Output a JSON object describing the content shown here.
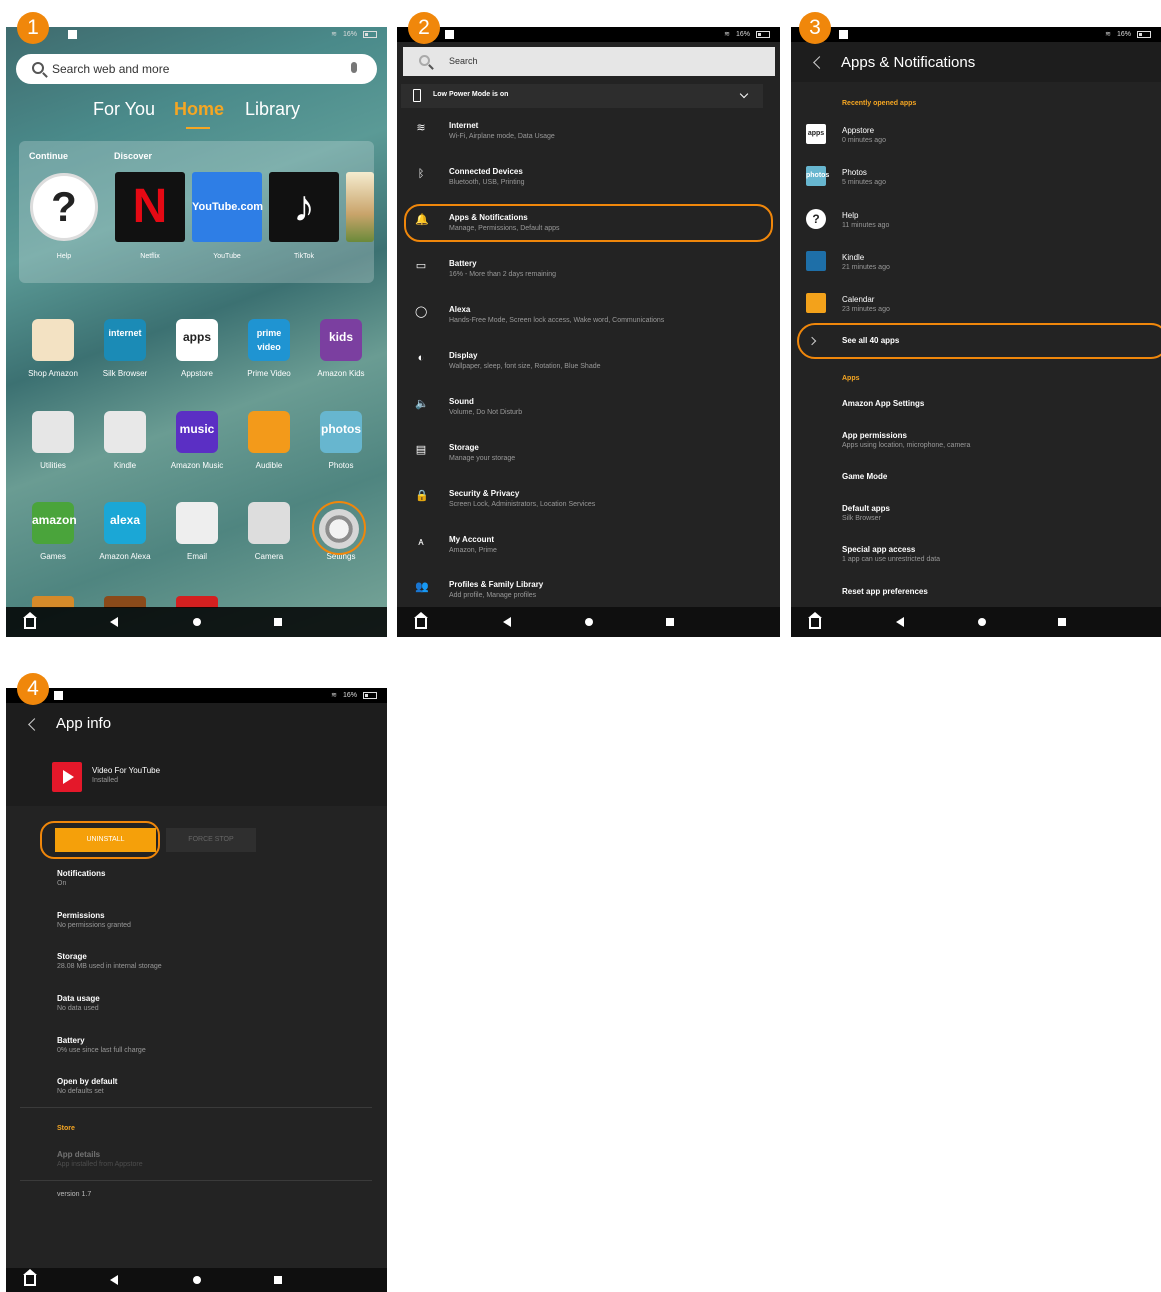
{
  "badges": [
    "1",
    "2",
    "3",
    "4"
  ],
  "status": {
    "battery": "16%"
  },
  "panel1": {
    "search_placeholder": "Search web and more",
    "tabs": [
      "For You",
      "Home",
      "Library"
    ],
    "carousel": {
      "continue_label": "Continue",
      "discover_label": "Discover",
      "tiles": [
        {
          "label": "Help",
          "glyph": "?"
        },
        {
          "label": "Netflix",
          "glyph": "N"
        },
        {
          "label": "YouTube",
          "glyph": "YouTube.com"
        },
        {
          "label": "TikTok",
          "glyph": "♪"
        }
      ]
    },
    "apps": [
      {
        "label": "Shop Amazon",
        "glyph": "",
        "color": "#f3e2c3"
      },
      {
        "label": "Silk Browser",
        "glyph": "internet",
        "color": "#1b8bb6"
      },
      {
        "label": "Appstore",
        "glyph": "apps",
        "color": "#ffffff"
      },
      {
        "label": "Prime Video",
        "glyph": "prime video",
        "color": "#1f94d2"
      },
      {
        "label": "Amazon Kids",
        "glyph": "kids",
        "color": "#7b3fa0"
      },
      {
        "label": "Utilities",
        "glyph": "",
        "color": "#e6e6e6"
      },
      {
        "label": "Kindle",
        "glyph": "",
        "color": "#e8e8e8"
      },
      {
        "label": "Amazon Music",
        "glyph": "music",
        "color": "#5b2fc4"
      },
      {
        "label": "Audible",
        "glyph": "",
        "color": "#f39a1a"
      },
      {
        "label": "Photos",
        "glyph": "photos",
        "color": "#67b6cf"
      },
      {
        "label": "Games",
        "glyph": "amazon",
        "color": "#4aa43b"
      },
      {
        "label": "Amazon Alexa",
        "glyph": "alexa",
        "color": "#1ba7d6"
      },
      {
        "label": "Email",
        "glyph": "",
        "color": "#eeeeee"
      },
      {
        "label": "Camera",
        "glyph": "",
        "color": "#dddddd"
      },
      {
        "label": "Settings",
        "glyph": "",
        "color": "#cfcfcf"
      }
    ]
  },
  "panel2": {
    "search_placeholder": "Search",
    "low_power": "Low Power Mode is on",
    "settings": [
      {
        "title": "Internet",
        "subtitle": "Wi-Fi, Airplane mode, Data Usage",
        "icon": "wifi-icon",
        "glyph": "≋"
      },
      {
        "title": "Connected Devices",
        "subtitle": "Bluetooth, USB, Printing",
        "icon": "bluetooth-icon",
        "glyph": "ᛒ"
      },
      {
        "title": "Apps & Notifications",
        "subtitle": "Manage, Permissions, Default apps",
        "icon": "bell-icon",
        "glyph": "🔔"
      },
      {
        "title": "Battery",
        "subtitle": "16% - More than 2 days remaining",
        "icon": "battery-icon",
        "glyph": "▭"
      },
      {
        "title": "Alexa",
        "subtitle": "Hands-Free Mode, Screen lock access, Wake word, Communications",
        "icon": "alexa-icon",
        "glyph": "◯"
      },
      {
        "title": "Display",
        "subtitle": "Wallpaper, sleep, font size, Rotation, Blue Shade",
        "icon": "display-icon",
        "glyph": "◐"
      },
      {
        "title": "Sound",
        "subtitle": "Volume, Do Not Disturb",
        "icon": "sound-icon",
        "glyph": "🔈"
      },
      {
        "title": "Storage",
        "subtitle": "Manage your storage",
        "icon": "storage-icon",
        "glyph": "▤"
      },
      {
        "title": "Security & Privacy",
        "subtitle": "Screen Lock, Administrators, Location Services",
        "icon": "lock-icon",
        "glyph": "🔒"
      },
      {
        "title": "My Account",
        "subtitle": "Amazon, Prime",
        "icon": "account-icon",
        "glyph": "ᴀ"
      },
      {
        "title": "Profiles & Family Library",
        "subtitle": "Add profile, Manage profiles",
        "icon": "profiles-icon",
        "glyph": "👥"
      }
    ]
  },
  "panel3": {
    "title": "Apps & Notifications",
    "recent_header": "Recently opened apps",
    "recent": [
      {
        "name": "Appstore",
        "time": "0 minutes ago",
        "glyph": "apps",
        "color": "#ffffff"
      },
      {
        "name": "Photos",
        "time": "5 minutes ago",
        "glyph": "photos",
        "color": "#67b6cf"
      },
      {
        "name": "Help",
        "time": "11 minutes ago",
        "glyph": "?",
        "color": "#ffffff"
      },
      {
        "name": "Kindle",
        "time": "21 minutes ago",
        "glyph": "",
        "color": "#1e6fa8"
      },
      {
        "name": "Calendar",
        "time": "23 minutes ago",
        "glyph": "",
        "color": "#f3a21b"
      }
    ],
    "see_all": "See all 40 apps",
    "apps_header": "Apps",
    "options": [
      {
        "title": "Amazon App Settings",
        "subtitle": ""
      },
      {
        "title": "App permissions",
        "subtitle": "Apps using location, microphone, camera"
      },
      {
        "title": "Game Mode",
        "subtitle": ""
      },
      {
        "title": "Default apps",
        "subtitle": "Silk Browser"
      },
      {
        "title": "Special app access",
        "subtitle": "1 app can use unrestricted data"
      },
      {
        "title": "Reset app preferences",
        "subtitle": ""
      }
    ]
  },
  "panel4": {
    "title": "App info",
    "app_name": "Video For YouTube",
    "app_status": "Installed",
    "uninstall": "UNINSTALL",
    "force_stop": "FORCE STOP",
    "rows": [
      {
        "title": "Notifications",
        "subtitle": "On"
      },
      {
        "title": "Permissions",
        "subtitle": "No permissions granted"
      },
      {
        "title": "Storage",
        "subtitle": "28.08 MB used in internal storage"
      },
      {
        "title": "Data usage",
        "subtitle": "No data used"
      },
      {
        "title": "Battery",
        "subtitle": "0% use since last full charge"
      },
      {
        "title": "Open by default",
        "subtitle": "No defaults set"
      }
    ],
    "store_header": "Store",
    "app_details": "App details",
    "app_details_sub": "App installed from Appstore",
    "version": "version 1.7"
  }
}
